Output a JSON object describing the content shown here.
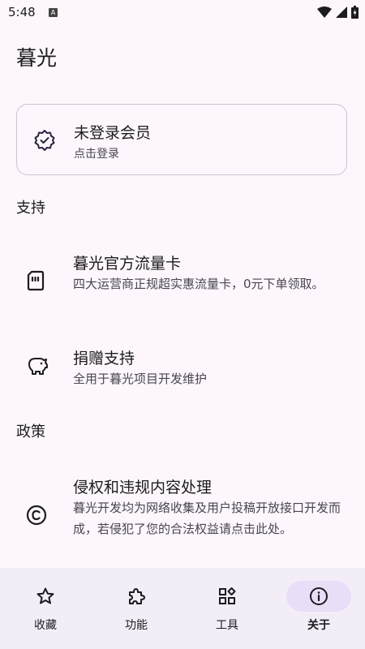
{
  "status_bar": {
    "time": "5:48",
    "notification_badge": "A"
  },
  "app": {
    "title": "暮光"
  },
  "member_card": {
    "title": "未登录会员",
    "subtitle": "点击登录"
  },
  "sections": {
    "support": {
      "header": "支持",
      "items": [
        {
          "title": "暮光官方流量卡",
          "desc": "四大运营商正规超实惠流量卡，0元下单领取。",
          "icon": "sim-card-icon"
        },
        {
          "title": "捐赠支持",
          "desc": "全用于暮光项目开发维护",
          "icon": "piggy-bank-icon"
        }
      ]
    },
    "policy": {
      "header": "政策",
      "items": [
        {
          "title": "侵权和违规内容处理",
          "desc": "暮光开发均为网络收集及用户投稿开放接口开发而成，若侵犯了您的合法权益请点击此处。",
          "icon": "copyright-icon"
        }
      ]
    }
  },
  "bottom_nav": {
    "items": [
      {
        "label": "收藏",
        "icon": "star-icon",
        "active": false
      },
      {
        "label": "功能",
        "icon": "puzzle-icon",
        "active": false
      },
      {
        "label": "工具",
        "icon": "widgets-icon",
        "active": false
      },
      {
        "label": "关于",
        "icon": "info-icon",
        "active": true
      }
    ]
  },
  "colors": {
    "background": "#fdf7fd",
    "nav_background": "#f3edf7",
    "active_indicator": "#e8def8",
    "text": "#1d1b20",
    "secondary_text": "#49454f"
  }
}
